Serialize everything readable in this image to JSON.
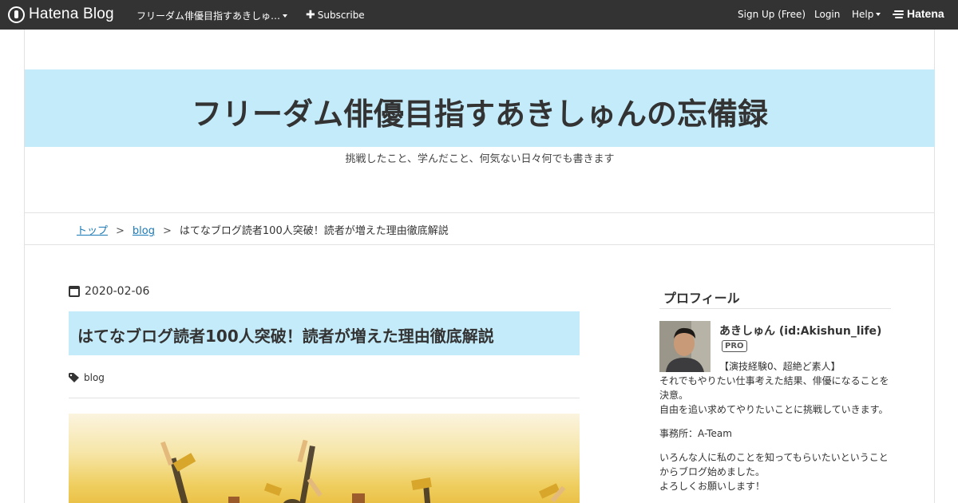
{
  "topbar": {
    "brand": "Hatena Blog",
    "blog_selector": "フリーダム俳優目指すあきしゅ…",
    "subscribe": "Subscribe",
    "signup": "Sign Up (Free)",
    "login": "Login",
    "help": "Help",
    "hatena": "Hatena"
  },
  "header": {
    "title": "フリーダム俳優目指すあきしゅんの忘備録",
    "description": "挑戦したこと、学んだこと、何気ない日々何でも書きます"
  },
  "breadcrumb": {
    "top": "トップ",
    "sep": ">",
    "category": "blog",
    "current": "はてなブログ読者100人突破！読者が増えた理由徹底解説"
  },
  "article": {
    "date": "2020-02-06",
    "title": "はてなブログ読者100人突破！読者が増えた理由徹底解説",
    "tag": "blog"
  },
  "sidebar": {
    "title": "プロフィール",
    "name": "あきしゅん (id:Akishun_life)",
    "badge": "PRO",
    "intro_line1": "【演技経験0、超絶ど素人】",
    "intro_line2": "それでもやりたい仕事考えた結果、俳優になることを決意。",
    "intro_line3": "自由を追い求めてやりたいことに挑戦していきます。",
    "office": "事務所：A-Team",
    "message": "いろんな人に私のことを知ってもらいたいということからブログ始めました。",
    "regards": "よろしくお願いします！"
  },
  "colors": {
    "topbar_bg": "#333333",
    "header_bg": "#c4ebf9",
    "link": "#1a7ab8"
  }
}
